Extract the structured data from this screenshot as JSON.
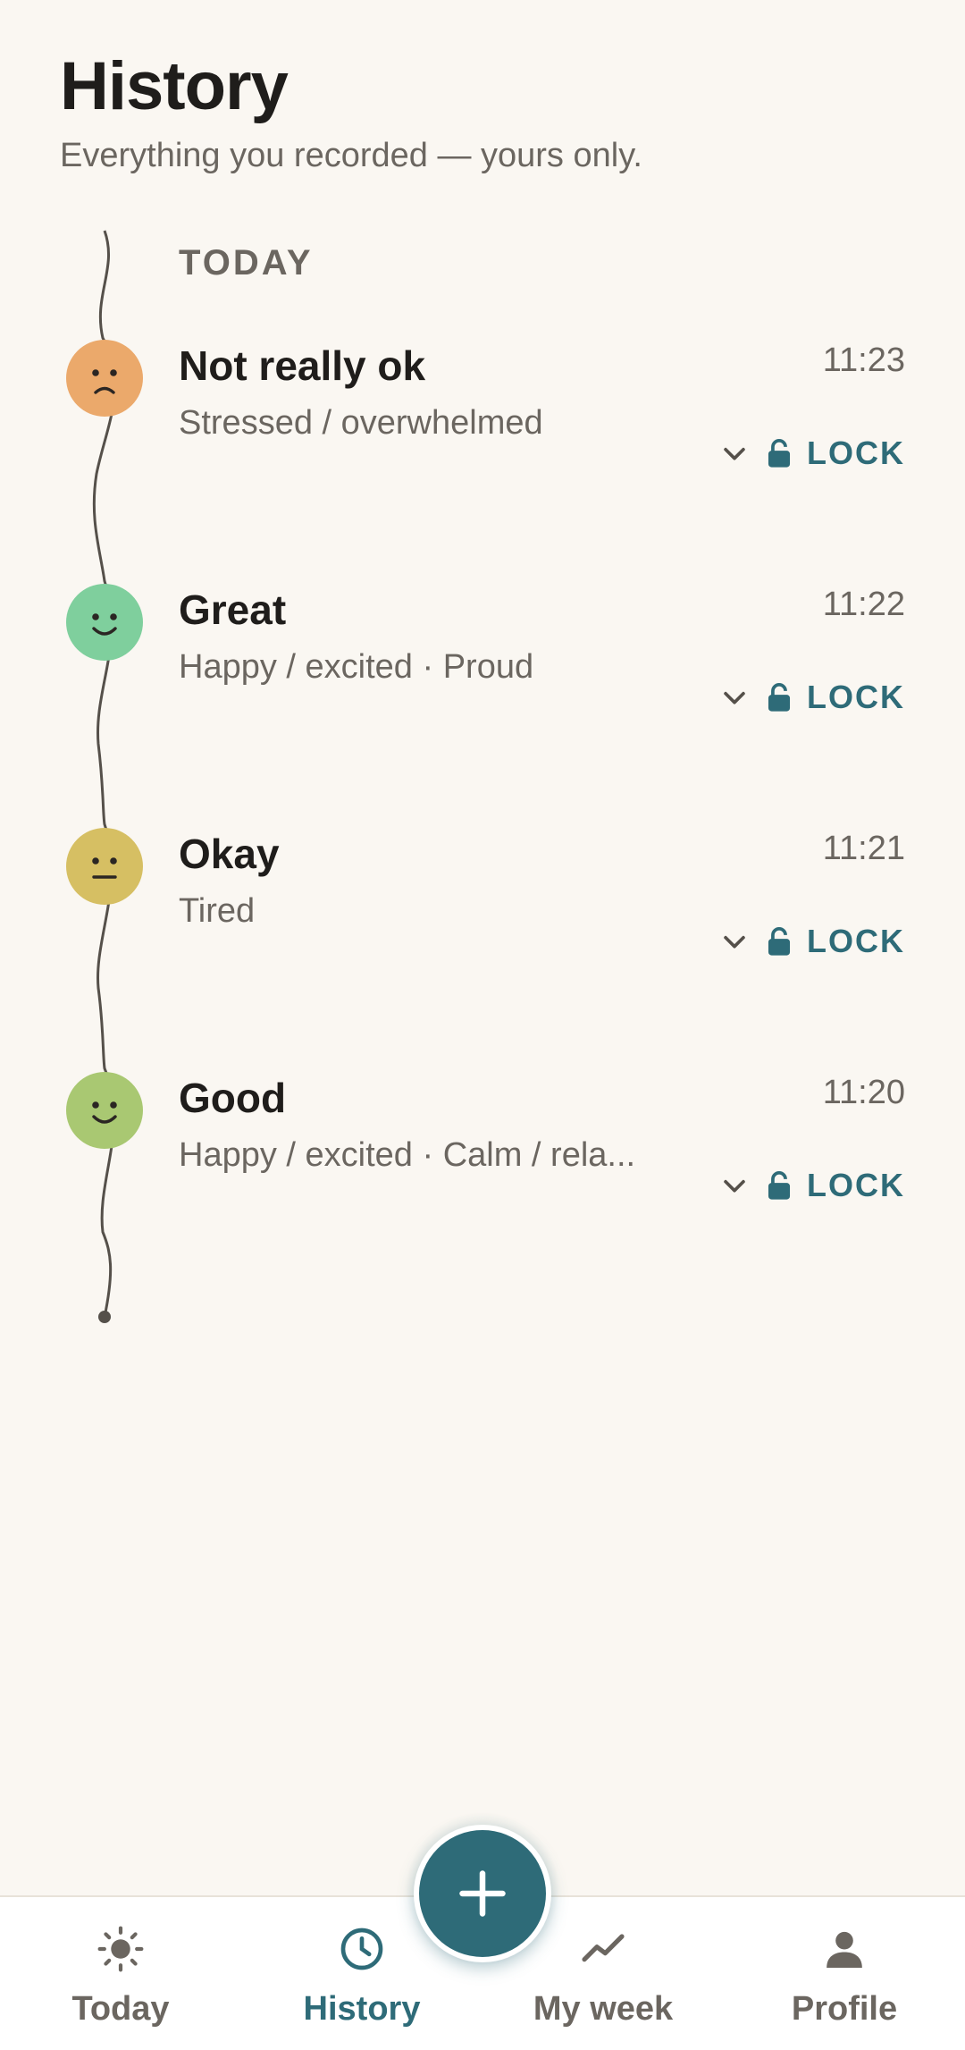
{
  "header": {
    "title": "History",
    "subtitle": "Everything you recorded — yours only."
  },
  "section": {
    "label": "TODAY"
  },
  "entries": [
    {
      "mood": "Not really ok",
      "tags": "Stressed / overwhelmed",
      "time": "11:23",
      "lock_label": "LOCK",
      "face": "sad",
      "color": "#eba96b"
    },
    {
      "mood": "Great",
      "tags": "Happy / excited · Proud",
      "time": "11:22",
      "lock_label": "LOCK",
      "face": "happy",
      "color": "#7fcf9d"
    },
    {
      "mood": "Okay",
      "tags": "Tired",
      "time": "11:21",
      "lock_label": "LOCK",
      "face": "neutral",
      "color": "#d6bf63"
    },
    {
      "mood": "Good",
      "tags": "Happy / excited · Calm / rela...",
      "time": "11:20",
      "lock_label": "LOCK",
      "face": "happy",
      "color": "#a9c872"
    }
  ],
  "nav": {
    "items": [
      {
        "label": "Today",
        "icon": "sun-icon",
        "active": false
      },
      {
        "label": "History",
        "icon": "clock-icon",
        "active": true
      },
      {
        "label": "My week",
        "icon": "trend-icon",
        "active": false
      },
      {
        "label": "Profile",
        "icon": "person-icon",
        "active": false
      }
    ],
    "fab_icon": "plus-icon"
  },
  "colors": {
    "accent": "#2e6b78",
    "background": "#faf7f2",
    "muted_text": "#6b6660"
  }
}
